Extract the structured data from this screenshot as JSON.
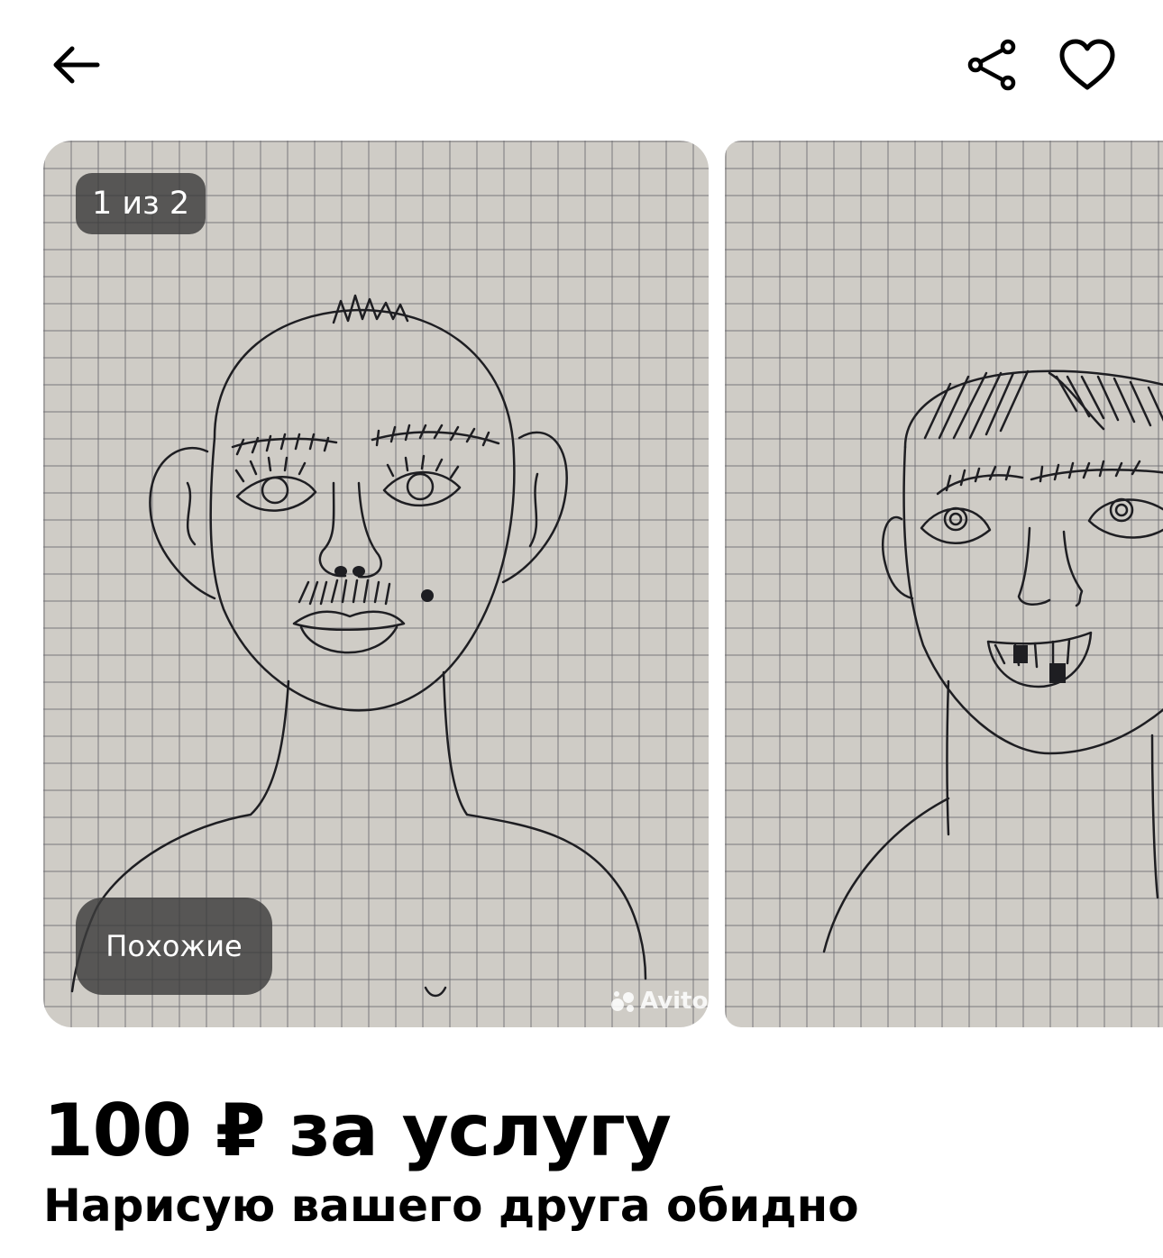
{
  "header": {
    "back_icon": "arrow-left-icon",
    "share_icon": "share-icon",
    "favorite_icon": "heart-outline-icon"
  },
  "gallery": {
    "counter": "1 из 2",
    "similar_label": "Похожие",
    "watermark": "Avito",
    "current_index": 1,
    "total": 2
  },
  "listing": {
    "price": "100 ₽ за услугу",
    "title": "Нарисую вашего друга обидно"
  }
}
